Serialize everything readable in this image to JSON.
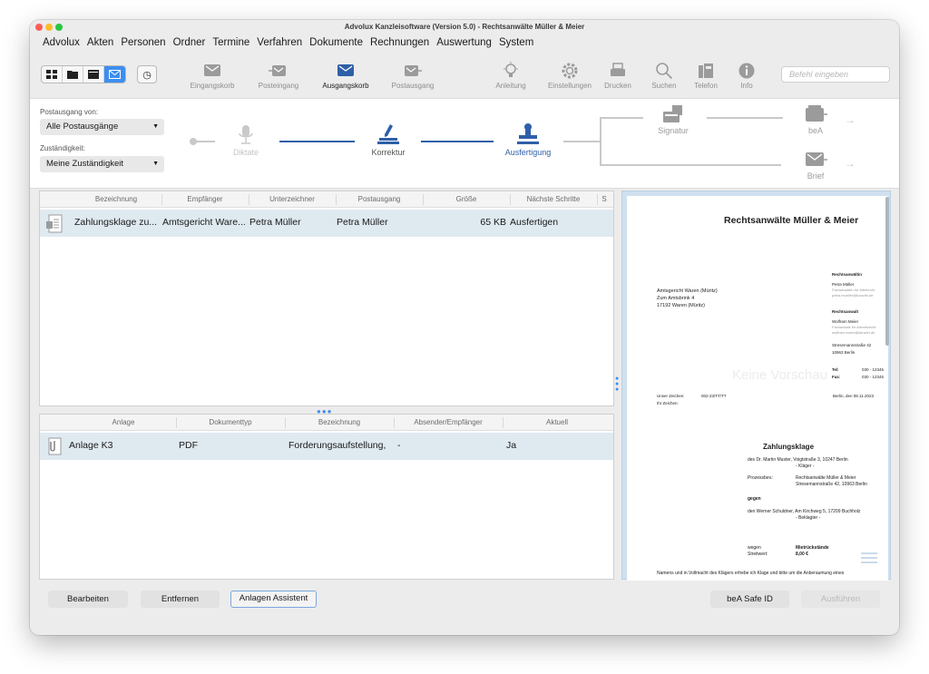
{
  "window": {
    "title": "Advolux Kanzleisoftware (Version 5.0) - Rechtsanwälte Müller & Meier"
  },
  "menu": [
    "Advolux",
    "Akten",
    "Personen",
    "Ordner",
    "Termine",
    "Verfahren",
    "Dokumente",
    "Rechnungen",
    "Auswertung",
    "System"
  ],
  "toolbar": {
    "items": [
      {
        "label": "Eingangskorb",
        "icon": "inbox-tray-icon"
      },
      {
        "label": "Posteingang",
        "icon": "mail-in-icon"
      },
      {
        "label": "Ausgangskorb",
        "icon": "outbox-tray-icon",
        "selected": true
      },
      {
        "label": "Postausgang",
        "icon": "mail-out-icon"
      },
      {
        "label": "Anleitung",
        "icon": "lightbulb-icon"
      },
      {
        "label": "Einstellungen",
        "icon": "gear-icon"
      },
      {
        "label": "Drucken",
        "icon": "printer-icon"
      },
      {
        "label": "Suchen",
        "icon": "magnifier-icon"
      },
      {
        "label": "Telefon",
        "icon": "phone-icon"
      },
      {
        "label": "Info",
        "icon": "info-icon"
      }
    ],
    "command_placeholder": "Befehl eingeben",
    "accent": "#3d8ef0"
  },
  "filters": {
    "postausgang_label": "Postausgang von:",
    "postausgang_value": "Alle Postausgänge",
    "zustaendigkeit_label": "Zuständigkeit:",
    "zustaendigkeit_value": "Meine Zuständigkeit"
  },
  "workflow": {
    "steps": [
      "Diktate",
      "Korrektur",
      "Ausfertigung"
    ],
    "outputs": [
      "Signatur",
      "beA",
      "Brief"
    ],
    "active_color": "#2f5fa8"
  },
  "documents": {
    "columns": [
      "Bezeichnung",
      "Empfänger",
      "Unterzeichner",
      "Postausgang",
      "Größe",
      "Nächste Schritte",
      "S"
    ],
    "rows": [
      {
        "bezeichnung": "Zahlungsklage zu...",
        "empfaenger": "Amtsgericht Ware...",
        "unterzeichner": "Petra Müller",
        "postausgang": "Petra Müller",
        "groesse": "65 KB",
        "naechste": "Ausfertigen"
      }
    ]
  },
  "attachments": {
    "columns": [
      "Anlage",
      "Dokumenttyp",
      "Bezeichnung",
      "Absender/Empfänger",
      "Aktuell"
    ],
    "rows": [
      {
        "anlage": "Anlage K3",
        "typ": "PDF",
        "bezeichnung": "Forderungsaufstellung,",
        "absender": "-",
        "aktuell": "Ja"
      }
    ]
  },
  "buttons": {
    "bearbeiten": "Bearbeiten",
    "entfernen": "Entfernen",
    "assistent": "Anlagen Assistent",
    "bea_safe_id": "beA Safe ID",
    "ausfuehren": "Ausführen"
  },
  "preview": {
    "firm": "Rechtsanwälte Müller & Meier",
    "recipient": [
      "Amtsgericht Waren (Müritz)",
      "Zum Amtsbrink 4",
      "17192 Waren (Müritz)"
    ],
    "sidebar": {
      "h1": "Rechtsanwältin",
      "p1": "Petra Müller",
      "p1a": "Fachanwältin für Mietrecht",
      "p1b": "petra.mueller@kanzlei.de",
      "h2": "Rechtsanwalt",
      "p2": "Wolfram Meier",
      "p2a": "Fachanwalt für Arbeitsrecht",
      "p2b": "wolfram.meier@kanzlei.de",
      "addr1": "Stresemannstraße 42",
      "addr2": "10963 Berlin",
      "tel_label": "Tel:",
      "tel": "030 - 12345",
      "fax_label": "Fax:",
      "fax": "030 - 12345"
    },
    "watermark": "Keine Vorschau",
    "unser_zeichen_label": "Unser Zeichen:",
    "unser_zeichen": "002-23/TT/TT",
    "ihr_zeichen_label": "Ihr Zeichen:",
    "date": "Berlin, den 08.11.2023",
    "heading": "Zahlungsklage",
    "line1": "des Dr. Martin Muster, Voigtstraße 3, 10247 Berlin",
    "line1b": "- Kläger -",
    "prozess_label": "Prozessbev.:",
    "prozess_1": "Rechtsanwälte Müller & Meier",
    "prozess_2": "Stresemannstraße 42, 10963 Berlin",
    "gegen": "gegen",
    "line2": "den Werner Schuldner, Am Kirchweg 5, 17209 Buchholz",
    "line2b": "- Beklagter -",
    "wegen_label": "wegen",
    "wegen": "Mietrückstände",
    "streitwert_label": "Streitwert:",
    "streitwert": "8,00 €",
    "footer_text": "Namens und in Vollmacht des Klägers erhebe ich Klage und bitte um die Anberaumung eines"
  }
}
